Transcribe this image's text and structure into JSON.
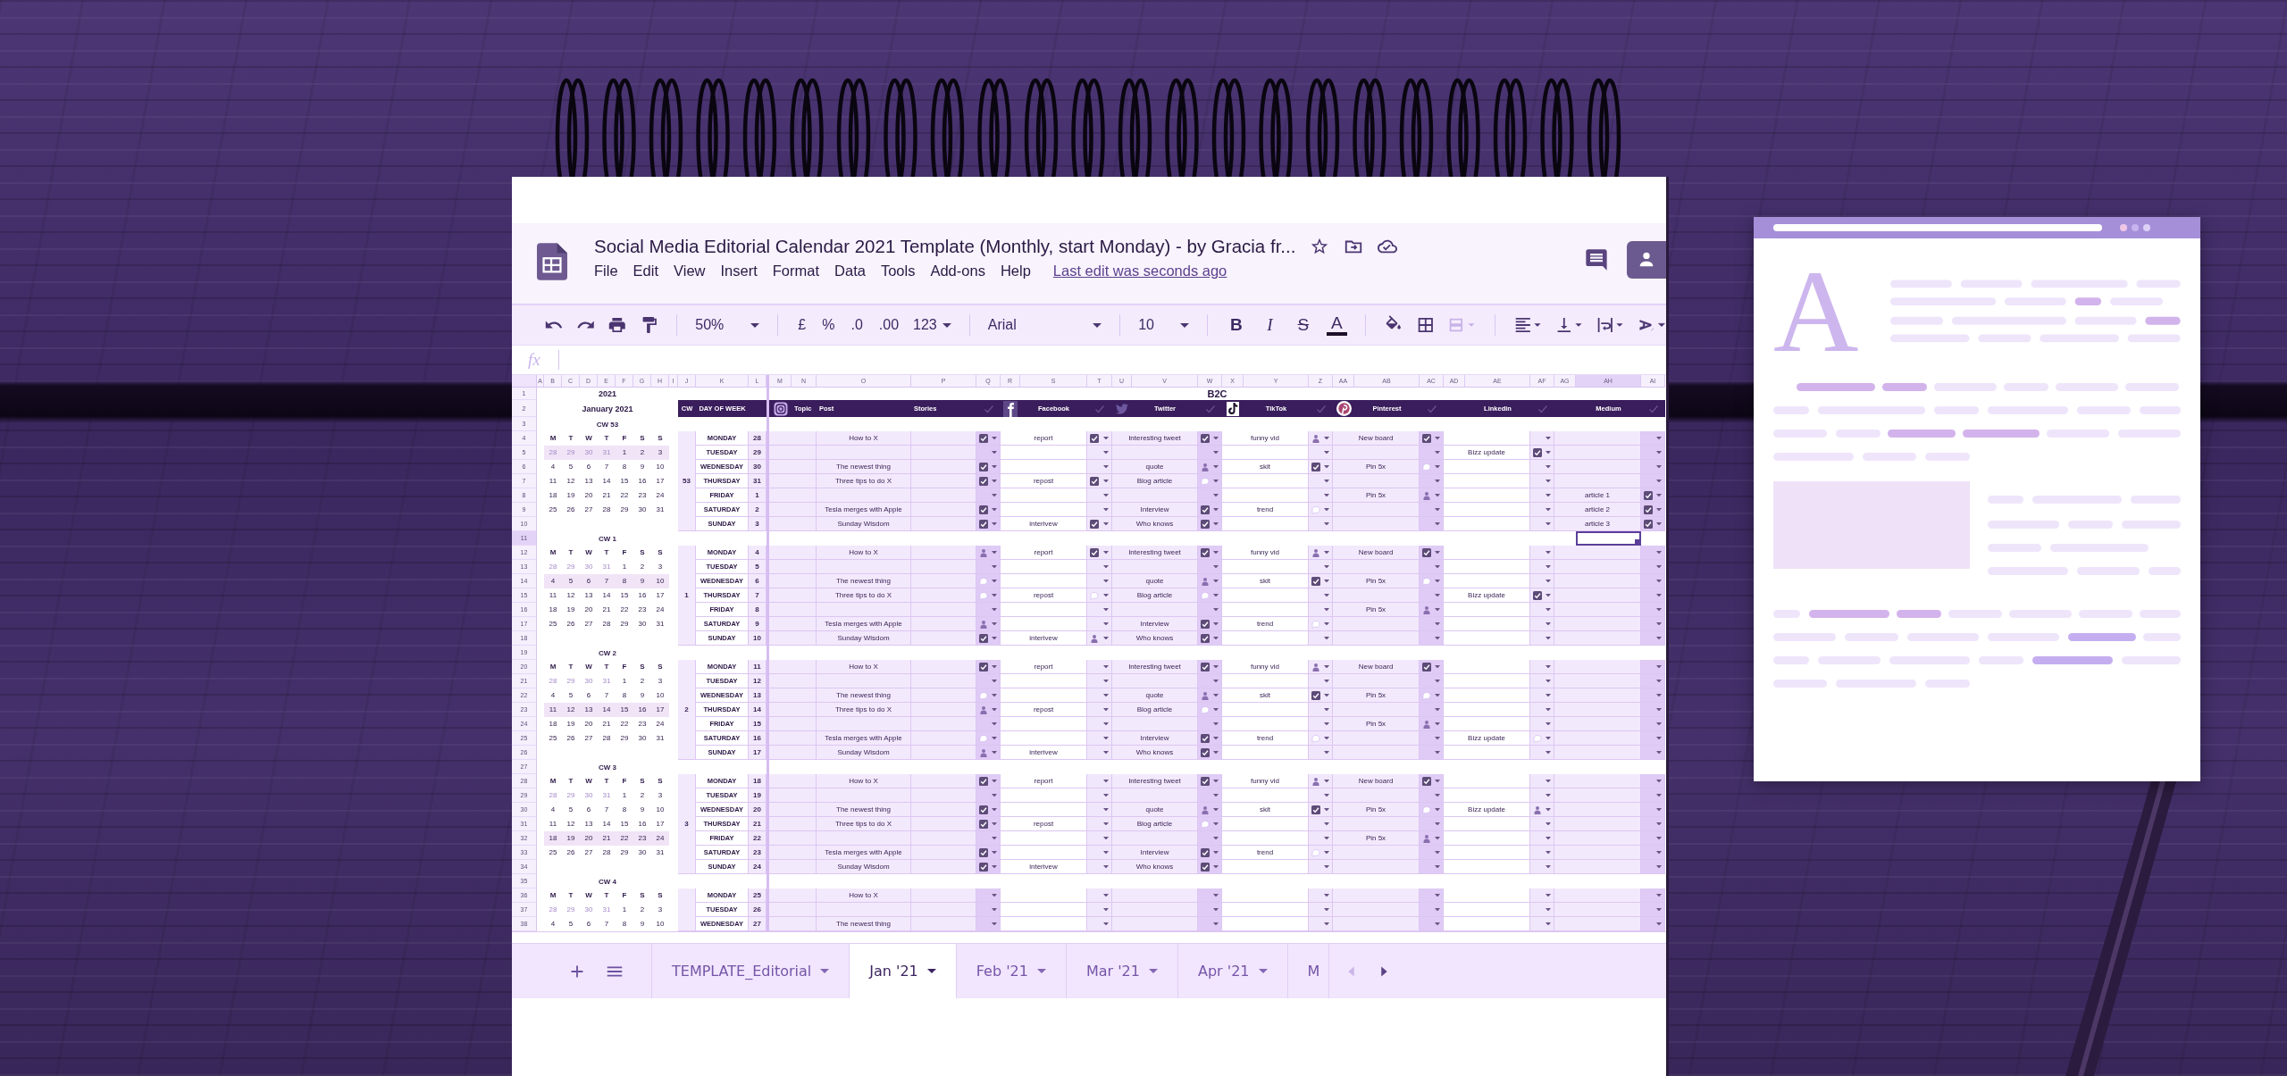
{
  "window": {
    "title": "Social Media Editorial Calendar 2021 Template (Monthly, start Monday) - by Gracia fr...",
    "menu": [
      "File",
      "Edit",
      "View",
      "Insert",
      "Format",
      "Data",
      "Tools",
      "Add-ons",
      "Help"
    ],
    "last_edit": "Last edit was seconds ago"
  },
  "toolbar": {
    "zoom": "50%",
    "currency": "£",
    "percent": "%",
    "decrease_decimals": ".0",
    "increase_decimals": ".00",
    "number_format": "123",
    "font": "Arial",
    "font_size": "10",
    "merge_disabled": true,
    "format_buttons": [
      {
        "kind": "bold",
        "label": "B"
      },
      {
        "kind": "italic",
        "label": "I"
      },
      {
        "kind": "strike",
        "label": "S"
      },
      {
        "kind": "color",
        "label": "A"
      }
    ]
  },
  "formula_bar": {
    "label": "fx"
  },
  "sheet": {
    "columns": [
      {
        "letter": "A",
        "selected": false
      },
      {
        "letter": "B",
        "selected": false
      },
      {
        "letter": "C",
        "selected": false
      },
      {
        "letter": "D",
        "selected": false
      },
      {
        "letter": "E",
        "selected": false
      },
      {
        "letter": "F",
        "selected": false
      },
      {
        "letter": "G",
        "selected": false
      },
      {
        "letter": "H",
        "selected": false
      },
      {
        "letter": "I",
        "selected": false
      },
      {
        "letter": "J",
        "selected": false
      },
      {
        "letter": "K",
        "selected": false
      },
      {
        "letter": "L",
        "selected": false
      },
      {
        "letter": "M",
        "selected": false
      },
      {
        "letter": "N",
        "selected": false
      },
      {
        "letter": "O",
        "selected": false
      },
      {
        "letter": "P",
        "selected": false
      },
      {
        "letter": "Q",
        "selected": false
      },
      {
        "letter": "R",
        "selected": false
      },
      {
        "letter": "S",
        "selected": false
      },
      {
        "letter": "T",
        "selected": false
      },
      {
        "letter": "U",
        "selected": false
      },
      {
        "letter": "V",
        "selected": false
      },
      {
        "letter": "W",
        "selected": false
      },
      {
        "letter": "X",
        "selected": false
      },
      {
        "letter": "Y",
        "selected": false
      },
      {
        "letter": "Z",
        "selected": false
      },
      {
        "letter": "AA",
        "selected": false
      },
      {
        "letter": "AB",
        "selected": false
      },
      {
        "letter": "AC",
        "selected": false
      },
      {
        "letter": "AD",
        "selected": false
      },
      {
        "letter": "AE",
        "selected": false
      },
      {
        "letter": "AF",
        "selected": false
      },
      {
        "letter": "AG",
        "selected": false
      },
      {
        "letter": "AH",
        "selected": true
      },
      {
        "letter": "AI",
        "selected": false
      }
    ],
    "rows": [
      {
        "number": "1",
        "selected": false
      },
      {
        "number": "2",
        "selected": false
      },
      {
        "number": "3",
        "selected": false
      },
      {
        "number": "4",
        "selected": false
      },
      {
        "number": "5",
        "selected": false
      },
      {
        "number": "6",
        "selected": false
      },
      {
        "number": "7",
        "selected": false
      },
      {
        "number": "8",
        "selected": false
      },
      {
        "number": "9",
        "selected": false
      },
      {
        "number": "10",
        "selected": false
      },
      {
        "number": "11",
        "selected": true
      },
      {
        "number": "12",
        "selected": false
      },
      {
        "number": "13",
        "selected": false
      },
      {
        "number": "14",
        "selected": false
      },
      {
        "number": "15",
        "selected": false
      },
      {
        "number": "16",
        "selected": false
      },
      {
        "number": "17",
        "selected": false
      },
      {
        "number": "18",
        "selected": false
      },
      {
        "number": "19",
        "selected": false
      },
      {
        "number": "20",
        "selected": false
      },
      {
        "number": "21",
        "selected": false
      },
      {
        "number": "22",
        "selected": false
      },
      {
        "number": "23",
        "selected": false
      },
      {
        "number": "24",
        "selected": false
      },
      {
        "number": "25",
        "selected": false
      },
      {
        "number": "26",
        "selected": false
      },
      {
        "number": "27",
        "selected": false
      },
      {
        "number": "28",
        "selected": false
      },
      {
        "number": "29",
        "selected": false
      },
      {
        "number": "30",
        "selected": false
      },
      {
        "number": "31",
        "selected": false
      },
      {
        "number": "32",
        "selected": false
      },
      {
        "number": "33",
        "selected": false
      },
      {
        "number": "34",
        "selected": false
      },
      {
        "number": "35",
        "selected": false
      },
      {
        "number": "36",
        "selected": false
      },
      {
        "number": "37",
        "selected": false
      },
      {
        "number": "38",
        "selected": false
      }
    ],
    "year": "2021",
    "month": "January 2021",
    "section": "B2C",
    "header": {
      "cw": "CW",
      "day": "DAY OF WEEK",
      "topic": "Topic",
      "post": "Post",
      "stories": "Stories",
      "platforms": [
        {
          "kind": "facebook",
          "name": "Facebook"
        },
        {
          "kind": "twitter",
          "name": "Twitter"
        },
        {
          "kind": "tiktok",
          "name": "TikTok"
        },
        {
          "kind": "pinterest",
          "name": "Pinterest"
        },
        {
          "kind": "plain",
          "name": "Linkedin"
        },
        {
          "kind": "plain",
          "name": "Medium"
        }
      ]
    },
    "calendars": [
      {
        "cw": "CW 53",
        "weekdays": [
          "M",
          "T",
          "W",
          "T",
          "F",
          "S",
          "S"
        ],
        "rows": [
          {
            "days": [
              "28",
              "29",
              "30",
              "31",
              "1",
              "2",
              "3"
            ],
            "muted": [
              true,
              true,
              true,
              true,
              false,
              false,
              false
            ],
            "selected": true
          },
          {
            "days": [
              "4",
              "5",
              "6",
              "7",
              "8",
              "9",
              "10"
            ],
            "muted": [
              false,
              false,
              false,
              false,
              false,
              false,
              false
            ],
            "selected": false
          },
          {
            "days": [
              "11",
              "12",
              "13",
              "14",
              "15",
              "16",
              "17"
            ],
            "muted": [
              false,
              false,
              false,
              false,
              false,
              false,
              false
            ],
            "selected": false
          },
          {
            "days": [
              "18",
              "19",
              "20",
              "21",
              "22",
              "23",
              "24"
            ],
            "muted": [
              false,
              false,
              false,
              false,
              false,
              false,
              false
            ],
            "selected": false
          },
          {
            "days": [
              "25",
              "26",
              "27",
              "28",
              "29",
              "30",
              "31"
            ],
            "muted": [
              false,
              false,
              false,
              false,
              false,
              false,
              false
            ],
            "selected": false
          }
        ]
      },
      {
        "cw": "CW 1",
        "weekdays": [
          "M",
          "T",
          "W",
          "T",
          "F",
          "S",
          "S"
        ],
        "rows": [
          {
            "days": [
              "28",
              "29",
              "30",
              "31",
              "1",
              "2",
              "3"
            ],
            "muted": [
              true,
              true,
              true,
              true,
              false,
              false,
              false
            ],
            "selected": false
          },
          {
            "days": [
              "4",
              "5",
              "6",
              "7",
              "8",
              "9",
              "10"
            ],
            "muted": [
              false,
              false,
              false,
              false,
              false,
              false,
              false
            ],
            "selected": true
          },
          {
            "days": [
              "11",
              "12",
              "13",
              "14",
              "15",
              "16",
              "17"
            ],
            "muted": [
              false,
              false,
              false,
              false,
              false,
              false,
              false
            ],
            "selected": false
          },
          {
            "days": [
              "18",
              "19",
              "20",
              "21",
              "22",
              "23",
              "24"
            ],
            "muted": [
              false,
              false,
              false,
              false,
              false,
              false,
              false
            ],
            "selected": false
          },
          {
            "days": [
              "25",
              "26",
              "27",
              "28",
              "29",
              "30",
              "31"
            ],
            "muted": [
              false,
              false,
              false,
              false,
              false,
              false,
              false
            ],
            "selected": false
          }
        ]
      },
      {
        "cw": "CW 2",
        "weekdays": [
          "M",
          "T",
          "W",
          "T",
          "F",
          "S",
          "S"
        ],
        "rows": [
          {
            "days": [
              "28",
              "29",
              "30",
              "31",
              "1",
              "2",
              "3"
            ],
            "muted": [
              true,
              true,
              true,
              true,
              false,
              false,
              false
            ],
            "selected": false
          },
          {
            "days": [
              "4",
              "5",
              "6",
              "7",
              "8",
              "9",
              "10"
            ],
            "muted": [
              false,
              false,
              false,
              false,
              false,
              false,
              false
            ],
            "selected": false
          },
          {
            "days": [
              "11",
              "12",
              "13",
              "14",
              "15",
              "16",
              "17"
            ],
            "muted": [
              false,
              false,
              false,
              false,
              false,
              false,
              false
            ],
            "selected": true
          },
          {
            "days": [
              "18",
              "19",
              "20",
              "21",
              "22",
              "23",
              "24"
            ],
            "muted": [
              false,
              false,
              false,
              false,
              false,
              false,
              false
            ],
            "selected": false
          },
          {
            "days": [
              "25",
              "26",
              "27",
              "28",
              "29",
              "30",
              "31"
            ],
            "muted": [
              false,
              false,
              false,
              false,
              false,
              false,
              false
            ],
            "selected": false
          }
        ]
      },
      {
        "cw": "CW 3",
        "weekdays": [
          "M",
          "T",
          "W",
          "T",
          "F",
          "S",
          "S"
        ],
        "rows": [
          {
            "days": [
              "28",
              "29",
              "30",
              "31",
              "1",
              "2",
              "3"
            ],
            "muted": [
              true,
              true,
              true,
              true,
              false,
              false,
              false
            ],
            "selected": false
          },
          {
            "days": [
              "4",
              "5",
              "6",
              "7",
              "8",
              "9",
              "10"
            ],
            "muted": [
              false,
              false,
              false,
              false,
              false,
              false,
              false
            ],
            "selected": false
          },
          {
            "days": [
              "11",
              "12",
              "13",
              "14",
              "15",
              "16",
              "17"
            ],
            "muted": [
              false,
              false,
              false,
              false,
              false,
              false,
              false
            ],
            "selected": false
          },
          {
            "days": [
              "18",
              "19",
              "20",
              "21",
              "22",
              "23",
              "24"
            ],
            "muted": [
              false,
              false,
              false,
              false,
              false,
              false,
              false
            ],
            "selected": true
          },
          {
            "days": [
              "25",
              "26",
              "27",
              "28",
              "29",
              "30",
              "31"
            ],
            "muted": [
              false,
              false,
              false,
              false,
              false,
              false,
              false
            ],
            "selected": false
          }
        ]
      },
      {
        "cw": "CW 4",
        "weekdays": [
          "M",
          "T",
          "W",
          "T",
          "F",
          "S",
          "S"
        ],
        "rows": [
          {
            "days": [
              "28",
              "29",
              "30",
              "31",
              "1",
              "2",
              "3"
            ],
            "muted": [
              true,
              true,
              true,
              true,
              false,
              false,
              false
            ],
            "selected": false
          },
          {
            "days": [
              "4",
              "5",
              "6",
              "7",
              "8",
              "9",
              "10"
            ],
            "muted": [
              false,
              false,
              false,
              false,
              false,
              false,
              false
            ],
            "selected": false
          }
        ]
      }
    ],
    "weeks": [
      {
        "cw": "53",
        "days": [
          {
            "day": "MONDAY",
            "date": "28",
            "channels": [
              {
                "text": "How to X",
                "kind": "checked"
              },
              {
                "text": "report",
                "kind": "checked"
              },
              {
                "text": "Interesting tweet",
                "kind": "checked"
              },
              {
                "text": "funny vid",
                "kind": "figure"
              },
              {
                "text": "New board",
                "kind": "checked"
              },
              {
                "kind": "none"
              },
              {
                "kind": "none"
              }
            ]
          },
          {
            "day": "TUESDAY",
            "date": "29",
            "channels": [
              {
                "kind": "none"
              },
              {
                "kind": "none"
              },
              {
                "kind": "none"
              },
              {
                "kind": "none"
              },
              {
                "kind": "none"
              },
              {
                "text": "Bizz update",
                "kind": "checked"
              },
              {
                "kind": "none"
              }
            ]
          },
          {
            "day": "WEDNESDAY",
            "date": "30",
            "channels": [
              {
                "text": "The newest thing",
                "kind": "checked"
              },
              {
                "kind": "none"
              },
              {
                "text": "quote",
                "kind": "figure"
              },
              {
                "text": "skit",
                "kind": "checked"
              },
              {
                "text": "Pin 5x",
                "kind": "bubble"
              },
              {
                "kind": "none"
              },
              {
                "kind": "none"
              }
            ]
          },
          {
            "day": "THURSDAY",
            "date": "31",
            "channels": [
              {
                "text": "Three tips to do X",
                "kind": "checked"
              },
              {
                "text": "repost",
                "kind": "checked"
              },
              {
                "text": "Blog article",
                "kind": "bubble"
              },
              {
                "kind": "none"
              },
              {
                "kind": "none"
              },
              {
                "kind": "none"
              },
              {
                "kind": "none"
              }
            ]
          },
          {
            "day": "FRIDAY",
            "date": "1",
            "channels": [
              {
                "kind": "none"
              },
              {
                "kind": "none"
              },
              {
                "kind": "none"
              },
              {
                "kind": "none"
              },
              {
                "text": "Pin 5x",
                "kind": "figure"
              },
              {
                "kind": "none"
              },
              {
                "text": "article 1",
                "kind": "checked"
              }
            ]
          },
          {
            "day": "SATURDAY",
            "date": "2",
            "channels": [
              {
                "text": "Tesla merges with Apple",
                "kind": "checked"
              },
              {
                "kind": "none"
              },
              {
                "text": "Interview",
                "kind": "checked"
              },
              {
                "text": "trend",
                "kind": "bubble"
              },
              {
                "kind": "none"
              },
              {
                "kind": "none"
              },
              {
                "text": "article 2",
                "kind": "checked"
              }
            ]
          },
          {
            "day": "SUNDAY",
            "date": "3",
            "channels": [
              {
                "text": "Sunday Wisdom",
                "kind": "checked"
              },
              {
                "text": "interivew",
                "kind": "checked"
              },
              {
                "text": "Who knows",
                "kind": "checked"
              },
              {
                "kind": "none"
              },
              {
                "kind": "none"
              },
              {
                "kind": "none"
              },
              {
                "text": "article 3",
                "kind": "checked"
              }
            ]
          }
        ]
      },
      {
        "cw": "1",
        "days": [
          {
            "day": "MONDAY",
            "date": "4",
            "channels": [
              {
                "text": "How to X",
                "kind": "figure"
              },
              {
                "text": "report",
                "kind": "checked"
              },
              {
                "text": "Interesting tweet",
                "kind": "checked"
              },
              {
                "text": "funny vid",
                "kind": "figure"
              },
              {
                "text": "New board",
                "kind": "checked"
              },
              {
                "kind": "none"
              },
              {
                "kind": "none"
              }
            ]
          },
          {
            "day": "TUESDAY",
            "date": "5",
            "channels": [
              {
                "kind": "none"
              },
              {
                "kind": "none"
              },
              {
                "kind": "none"
              },
              {
                "kind": "none"
              },
              {
                "kind": "none"
              },
              {
                "kind": "none"
              },
              {
                "kind": "none"
              }
            ]
          },
          {
            "day": "WEDNESDAY",
            "date": "6",
            "channels": [
              {
                "text": "The newest thing",
                "kind": "bubble"
              },
              {
                "kind": "none"
              },
              {
                "text": "quote",
                "kind": "figure"
              },
              {
                "text": "skit",
                "kind": "checked"
              },
              {
                "text": "Pin 5x",
                "kind": "bubble"
              },
              {
                "kind": "none"
              },
              {
                "kind": "none"
              }
            ]
          },
          {
            "day": "THURSDAY",
            "date": "7",
            "channels": [
              {
                "text": "Three tips to do X",
                "kind": "bubble"
              },
              {
                "text": "repost",
                "kind": "bubble"
              },
              {
                "text": "Blog article",
                "kind": "bubble"
              },
              {
                "kind": "none"
              },
              {
                "kind": "none"
              },
              {
                "text": "Bizz update",
                "kind": "checked"
              },
              {
                "kind": "none"
              }
            ]
          },
          {
            "day": "FRIDAY",
            "date": "8",
            "channels": [
              {
                "kind": "none"
              },
              {
                "kind": "none"
              },
              {
                "kind": "none"
              },
              {
                "kind": "none"
              },
              {
                "text": "Pin 5x",
                "kind": "figure"
              },
              {
                "kind": "none"
              },
              {
                "kind": "none"
              }
            ]
          },
          {
            "day": "SATURDAY",
            "date": "9",
            "channels": [
              {
                "text": "Tesla merges with Apple",
                "kind": "figure"
              },
              {
                "kind": "none"
              },
              {
                "text": "Interview",
                "kind": "checked"
              },
              {
                "text": "trend",
                "kind": "bubble"
              },
              {
                "kind": "none"
              },
              {
                "kind": "none"
              },
              {
                "kind": "none"
              }
            ]
          },
          {
            "day": "SUNDAY",
            "date": "10",
            "channels": [
              {
                "text": "Sunday Wisdom",
                "kind": "checked"
              },
              {
                "text": "interivew",
                "kind": "figure"
              },
              {
                "text": "Who knows",
                "kind": "checked"
              },
              {
                "kind": "none"
              },
              {
                "kind": "none"
              },
              {
                "kind": "none"
              },
              {
                "kind": "none"
              }
            ]
          }
        ]
      },
      {
        "cw": "2",
        "days": [
          {
            "day": "MONDAY",
            "date": "11",
            "channels": [
              {
                "text": "How to X",
                "kind": "checked"
              },
              {
                "text": "report",
                "kind": "none"
              },
              {
                "text": "Interesting tweet",
                "kind": "checked"
              },
              {
                "text": "funny vid",
                "kind": "figure"
              },
              {
                "text": "New board",
                "kind": "checked"
              },
              {
                "kind": "none"
              },
              {
                "kind": "none"
              }
            ]
          },
          {
            "day": "TUESDAY",
            "date": "12",
            "channels": [
              {
                "kind": "none"
              },
              {
                "kind": "none"
              },
              {
                "kind": "none"
              },
              {
                "kind": "none"
              },
              {
                "kind": "none"
              },
              {
                "kind": "none"
              },
              {
                "kind": "none"
              }
            ]
          },
          {
            "day": "WEDNESDAY",
            "date": "13",
            "channels": [
              {
                "text": "The newest thing",
                "kind": "bubble"
              },
              {
                "kind": "none"
              },
              {
                "text": "quote",
                "kind": "figure"
              },
              {
                "text": "skit",
                "kind": "checked"
              },
              {
                "text": "Pin 5x",
                "kind": "bubble"
              },
              {
                "kind": "none"
              },
              {
                "kind": "none"
              }
            ]
          },
          {
            "day": "THURSDAY",
            "date": "14",
            "channels": [
              {
                "text": "Three tips to do X",
                "kind": "figure"
              },
              {
                "text": "repost",
                "kind": "none"
              },
              {
                "text": "Blog article",
                "kind": "bubble"
              },
              {
                "kind": "none"
              },
              {
                "kind": "none"
              },
              {
                "kind": "none"
              },
              {
                "kind": "none"
              }
            ]
          },
          {
            "day": "FRIDAY",
            "date": "15",
            "channels": [
              {
                "kind": "none"
              },
              {
                "kind": "none"
              },
              {
                "kind": "none"
              },
              {
                "kind": "none"
              },
              {
                "text": "Pin 5x",
                "kind": "figure"
              },
              {
                "kind": "none"
              },
              {
                "kind": "none"
              }
            ]
          },
          {
            "day": "SATURDAY",
            "date": "16",
            "channels": [
              {
                "text": "Tesla merges with Apple",
                "kind": "bubble"
              },
              {
                "kind": "none"
              },
              {
                "text": "Interview",
                "kind": "checked"
              },
              {
                "text": "trend",
                "kind": "bubble"
              },
              {
                "kind": "none"
              },
              {
                "text": "Bizz update",
                "kind": "bubble"
              },
              {
                "kind": "none"
              }
            ]
          },
          {
            "day": "SUNDAY",
            "date": "17",
            "channels": [
              {
                "text": "Sunday Wisdom",
                "kind": "figure"
              },
              {
                "text": "interivew",
                "kind": "none"
              },
              {
                "text": "Who knows",
                "kind": "checked"
              },
              {
                "kind": "none"
              },
              {
                "kind": "none"
              },
              {
                "kind": "none"
              },
              {
                "kind": "none"
              }
            ]
          }
        ]
      },
      {
        "cw": "3",
        "days": [
          {
            "day": "MONDAY",
            "date": "18",
            "channels": [
              {
                "text": "How to X",
                "kind": "checked"
              },
              {
                "text": "report",
                "kind": "none"
              },
              {
                "text": "Interesting tweet",
                "kind": "checked"
              },
              {
                "text": "funny vid",
                "kind": "figure"
              },
              {
                "text": "New board",
                "kind": "checked"
              },
              {
                "kind": "none"
              },
              {
                "kind": "none"
              }
            ]
          },
          {
            "day": "TUESDAY",
            "date": "19",
            "channels": [
              {
                "kind": "none"
              },
              {
                "kind": "none"
              },
              {
                "kind": "none"
              },
              {
                "kind": "none"
              },
              {
                "kind": "none"
              },
              {
                "kind": "none"
              },
              {
                "kind": "none"
              }
            ]
          },
          {
            "day": "WEDNESDAY",
            "date": "20",
            "channels": [
              {
                "text": "The newest thing",
                "kind": "checked"
              },
              {
                "kind": "none"
              },
              {
                "text": "quote",
                "kind": "figure"
              },
              {
                "text": "skit",
                "kind": "checked"
              },
              {
                "text": "Pin 5x",
                "kind": "bubble"
              },
              {
                "text": "Bizz update",
                "kind": "figure"
              },
              {
                "kind": "none"
              }
            ]
          },
          {
            "day": "THURSDAY",
            "date": "21",
            "channels": [
              {
                "text": "Three tips to do X",
                "kind": "checked"
              },
              {
                "text": "repost",
                "kind": "none"
              },
              {
                "text": "Blog article",
                "kind": "bubble"
              },
              {
                "kind": "none"
              },
              {
                "kind": "none"
              },
              {
                "kind": "none"
              },
              {
                "kind": "none"
              }
            ]
          },
          {
            "day": "FRIDAY",
            "date": "22",
            "channels": [
              {
                "kind": "none"
              },
              {
                "kind": "none"
              },
              {
                "kind": "none"
              },
              {
                "kind": "none"
              },
              {
                "text": "Pin 5x",
                "kind": "figure"
              },
              {
                "kind": "none"
              },
              {
                "kind": "none"
              }
            ]
          },
          {
            "day": "SATURDAY",
            "date": "23",
            "channels": [
              {
                "text": "Tesla merges with Apple",
                "kind": "checked"
              },
              {
                "kind": "none"
              },
              {
                "text": "Interview",
                "kind": "checked"
              },
              {
                "text": "trend",
                "kind": "bubble"
              },
              {
                "kind": "none"
              },
              {
                "kind": "none"
              },
              {
                "kind": "none"
              }
            ]
          },
          {
            "day": "SUNDAY",
            "date": "24",
            "channels": [
              {
                "text": "Sunday Wisdom",
                "kind": "checked"
              },
              {
                "text": "interivew",
                "kind": "none"
              },
              {
                "text": "Who knows",
                "kind": "checked"
              },
              {
                "kind": "none"
              },
              {
                "kind": "none"
              },
              {
                "kind": "none"
              },
              {
                "kind": "none"
              }
            ]
          }
        ]
      },
      {
        "days": [
          {
            "day": "MONDAY",
            "date": "25",
            "channels": [
              {
                "text": "How to X",
                "kind": "none"
              },
              {
                "kind": "none"
              },
              {
                "kind": "none"
              },
              {
                "kind": "none"
              },
              {
                "kind": "none"
              },
              {
                "kind": "none"
              },
              {
                "kind": "none"
              }
            ]
          },
          {
            "day": "TUESDAY",
            "date": "26",
            "channels": [
              {
                "kind": "none"
              },
              {
                "kind": "none"
              },
              {
                "kind": "none"
              },
              {
                "kind": "none"
              },
              {
                "kind": "none"
              },
              {
                "kind": "none"
              },
              {
                "kind": "none"
              }
            ]
          },
          {
            "day": "WEDNESDAY",
            "date": "27",
            "channels": [
              {
                "text": "The newest thing",
                "kind": "none"
              },
              {
                "kind": "none"
              },
              {
                "kind": "none"
              },
              {
                "kind": "none"
              },
              {
                "kind": "none"
              },
              {
                "kind": "none"
              },
              {
                "kind": "none"
              }
            ]
          }
        ]
      }
    ]
  },
  "tabs": [
    {
      "label": "TEMPLATE_Editorial",
      "selected": false
    },
    {
      "label": "Jan '21",
      "selected": true
    },
    {
      "label": "Feb '21",
      "selected": false
    },
    {
      "label": "Mar '21",
      "selected": false
    },
    {
      "label": "Apr '21",
      "selected": false
    },
    {
      "label": "M",
      "selected": false
    }
  ],
  "tab_scroll": {
    "back_disabled": true,
    "forward_disabled": false
  },
  "document_mockup": {
    "letter": "A"
  }
}
